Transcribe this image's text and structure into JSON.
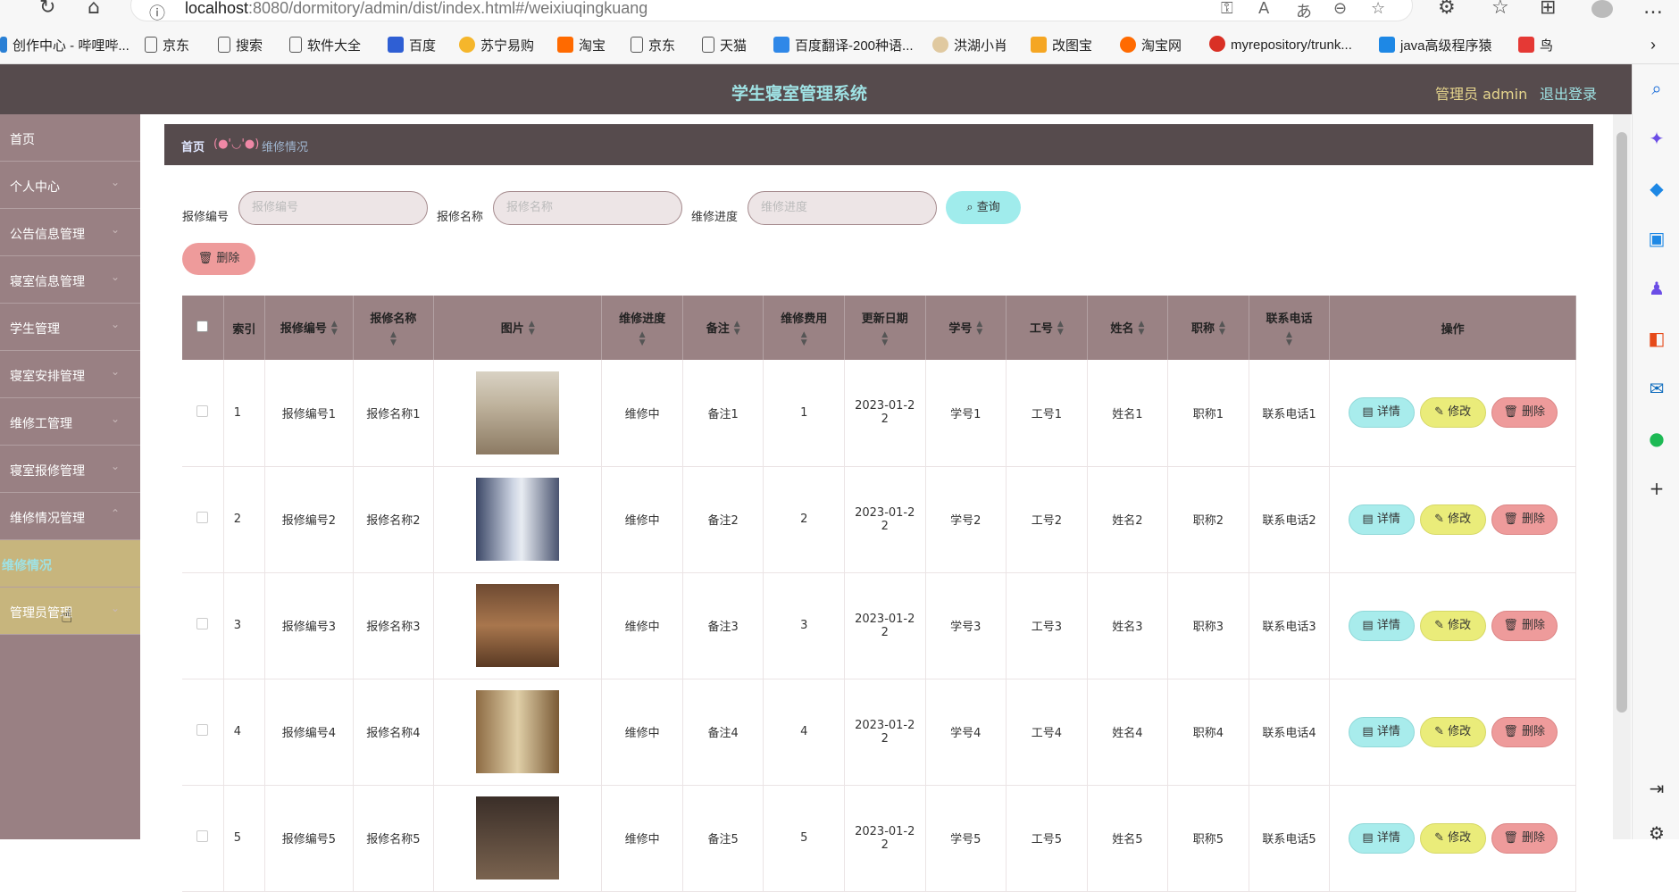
{
  "browser": {
    "url_host": "localhost",
    "url_rest": ":8080/dormitory/admin/dist/index.html#/weixiuqingkuang",
    "bookmarks": [
      "创作中心 - 哔哩哔...",
      "京东",
      "搜索",
      "软件大全",
      "百度",
      "苏宁易购",
      "淘宝",
      "京东",
      "天猫",
      "百度翻译-200种语...",
      "洪湖小肖",
      "改图宝",
      "淘宝网",
      "myrepository/trunk...",
      "java高级程序猿",
      "鸟"
    ]
  },
  "header": {
    "title": "学生寝室管理系统",
    "admin_label": "管理员 admin",
    "logout": "退出登录"
  },
  "sidebar": {
    "items": [
      "首页",
      "个人中心",
      "公告信息管理",
      "寝室信息管理",
      "学生管理",
      "寝室安排管理",
      "维修工管理",
      "寝室报修管理",
      "维修情况管理"
    ],
    "sub_item": "维修情况",
    "admin_item": "管理员管理"
  },
  "breadcrumb": {
    "home": "首页",
    "sep": "(●'◡'●)",
    "current": "维修情况"
  },
  "search": {
    "f1_label": "报修编号",
    "f1_placeholder": "报修编号",
    "f2_label": "报修名称",
    "f2_placeholder": "报修名称",
    "f3_label": "维修进度",
    "f3_placeholder": "维修进度",
    "query": "查询",
    "delete": "删除"
  },
  "table": {
    "columns": [
      "索引",
      "报修编号",
      "报修名称",
      "图片",
      "维修进度",
      "备注",
      "维修费用",
      "更新日期",
      "学号",
      "工号",
      "姓名",
      "职称",
      "联系电话",
      "操作"
    ],
    "ops": {
      "detail": "详情",
      "edit": "修改",
      "delete": "删除"
    },
    "rows": [
      {
        "index": "1",
        "no": "报修编号1",
        "name": "报修名称1",
        "progress": "维修中",
        "note": "备注1",
        "fee": "1",
        "date": "2023-01-22",
        "sid": "学号1",
        "wid": "工号1",
        "pname": "姓名1",
        "title": "职称1",
        "phone": "联系电话1"
      },
      {
        "index": "2",
        "no": "报修编号2",
        "name": "报修名称2",
        "progress": "维修中",
        "note": "备注2",
        "fee": "2",
        "date": "2023-01-22",
        "sid": "学号2",
        "wid": "工号2",
        "pname": "姓名2",
        "title": "职称2",
        "phone": "联系电话2"
      },
      {
        "index": "3",
        "no": "报修编号3",
        "name": "报修名称3",
        "progress": "维修中",
        "note": "备注3",
        "fee": "3",
        "date": "2023-01-22",
        "sid": "学号3",
        "wid": "工号3",
        "pname": "姓名3",
        "title": "职称3",
        "phone": "联系电话3"
      },
      {
        "index": "4",
        "no": "报修编号4",
        "name": "报修名称4",
        "progress": "维修中",
        "note": "备注4",
        "fee": "4",
        "date": "2023-01-22",
        "sid": "学号4",
        "wid": "工号4",
        "pname": "姓名4",
        "title": "职称4",
        "phone": "联系电话4"
      },
      {
        "index": "5",
        "no": "报修编号5",
        "name": "报修名称5",
        "progress": "维修中",
        "note": "备注5",
        "fee": "5",
        "date": "2023-01-22",
        "sid": "学号5",
        "wid": "工号5",
        "pname": "姓名5",
        "title": "职称5",
        "phone": "联系电话5"
      }
    ]
  },
  "colors": {
    "header_bg": "#564b4d",
    "sidebar_bg": "#998083",
    "accent_cyan": "#9fe2e4",
    "accent_yellow": "#eaec7a",
    "accent_red": "#ee9b9b"
  }
}
